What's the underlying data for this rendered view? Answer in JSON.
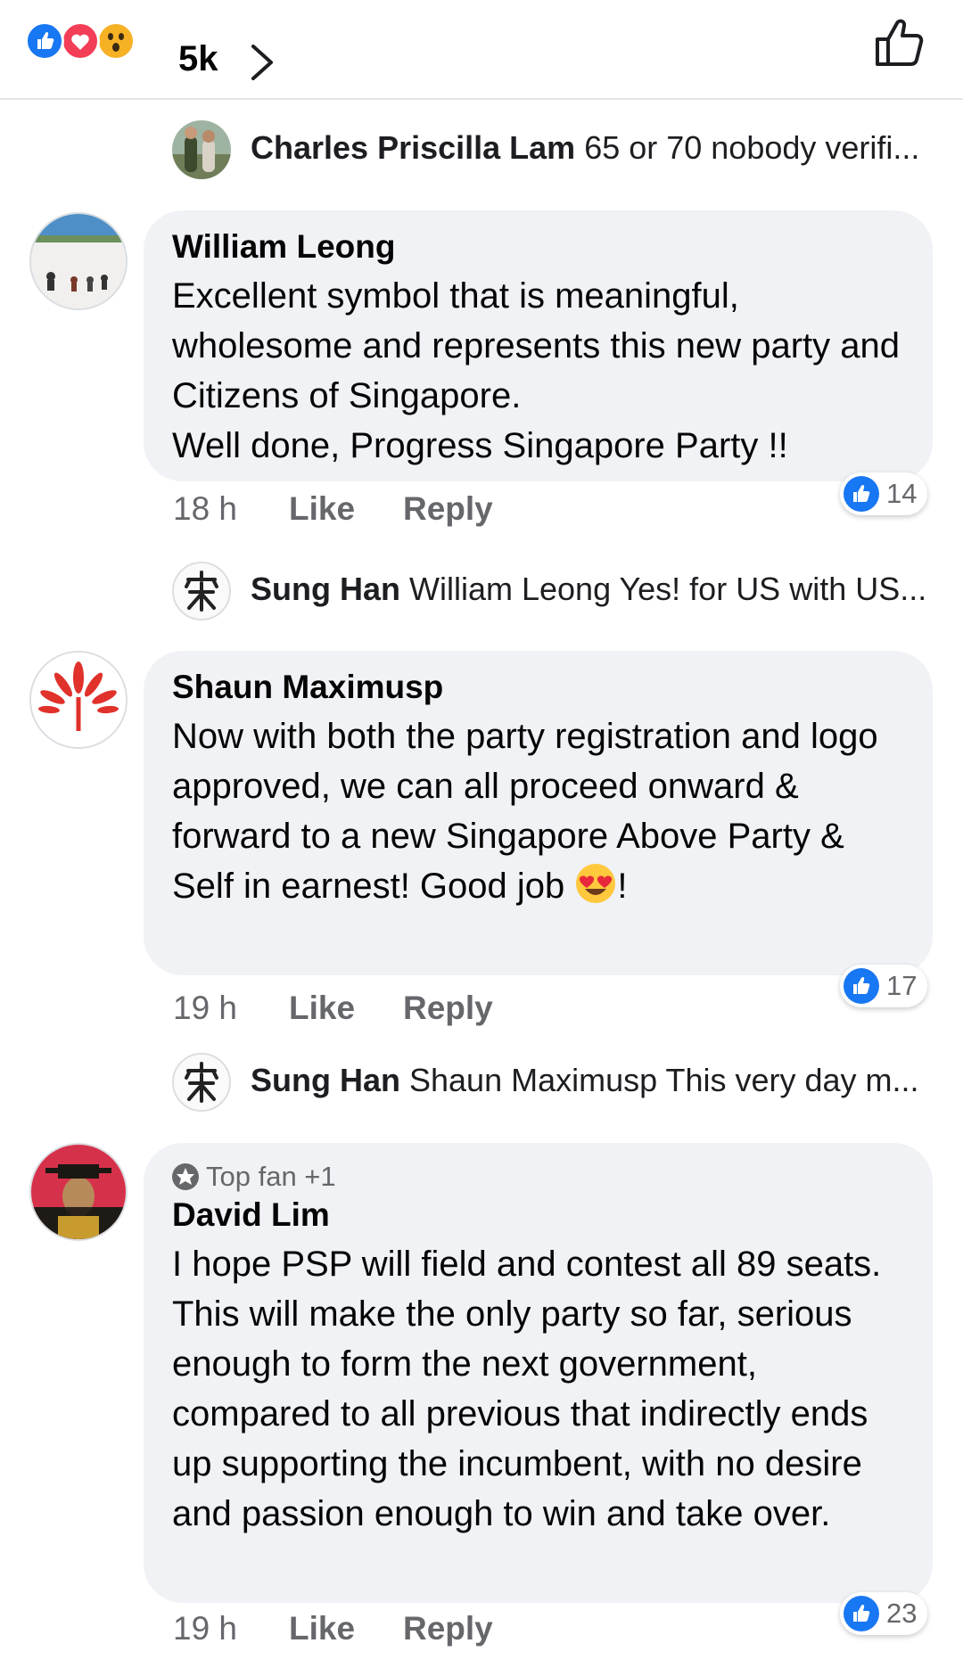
{
  "reactions": {
    "icons": [
      "like-icon",
      "love-icon",
      "wow-icon"
    ],
    "count": "5k",
    "colors": {
      "like": "#1877f2",
      "love": "#f33e58",
      "wow": "#f7b125"
    }
  },
  "replies": [
    {
      "name": "Charles Priscilla Lam",
      "snippet": "65 or 70 nobody verifi..."
    },
    {
      "name": "Sung Han",
      "snippet": "William Leong Yes! for US with US..."
    },
    {
      "name": "Sung Han",
      "snippet": "Shaun Maximusp This very day m..."
    }
  ],
  "comments": [
    {
      "author": "William Leong",
      "text": "Excellent symbol that is meaningful, wholesome and represents this new party and Citizens of Singapore.\nWell done, Progress Singapore Party !!",
      "time": "18 h",
      "like_label": "Like",
      "reply_label": "Reply",
      "like_count": "14"
    },
    {
      "author": "Shaun Maximusp",
      "text_before_emoji": "Now with both the party registration and logo approved, we can all proceed onward & forward to a new Singapore Above Party & Self in earnest! Good job ",
      "text_after_emoji": "!",
      "emoji": "heart-eyes-emoji",
      "time": "19 h",
      "like_label": "Like",
      "reply_label": "Reply",
      "like_count": "17"
    },
    {
      "badge": "Top fan +1",
      "author": "David Lim",
      "text": "I hope PSP will field and contest all 89 seats. This will make the only party so far, serious enough to form the next government, compared to all previous that indirectly ends up supporting the incumbent, with no desire and passion enough to win and take over.",
      "time": "19 h",
      "like_label": "Like",
      "reply_label": "Reply",
      "like_count": "23"
    }
  ]
}
